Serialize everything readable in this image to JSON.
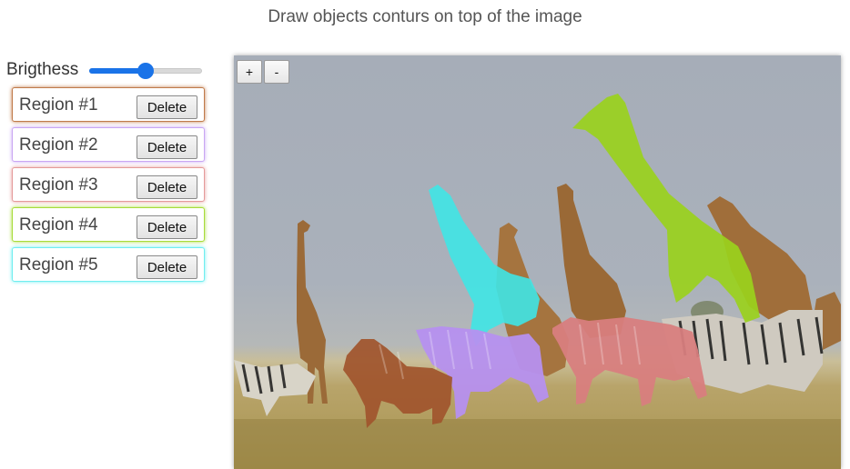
{
  "header": {
    "title": "Draw objects conturs on top of the image"
  },
  "brightness": {
    "label": "Brigthess",
    "value_fraction": 0.5
  },
  "regions": [
    {
      "name": "Region #1",
      "delete_label": "Delete",
      "border_color": "#c07a4a",
      "mask_color": "#a0552d"
    },
    {
      "name": "Region #2",
      "delete_label": "Delete",
      "border_color": "#c9a6f3",
      "mask_color": "#b690ef"
    },
    {
      "name": "Region #3",
      "delete_label": "Delete",
      "border_color": "#e59a9a",
      "mask_color": "#d87e7e"
    },
    {
      "name": "Region #4",
      "delete_label": "Delete",
      "border_color": "#a8dc3a",
      "mask_color": "#9ad11c"
    },
    {
      "name": "Region #5",
      "delete_label": "Delete",
      "border_color": "#6feef0",
      "mask_color": "#3fe6e6"
    }
  ],
  "zoom": {
    "in_label": "+",
    "out_label": "-"
  },
  "colors": {
    "accent": "#1a73e8"
  }
}
